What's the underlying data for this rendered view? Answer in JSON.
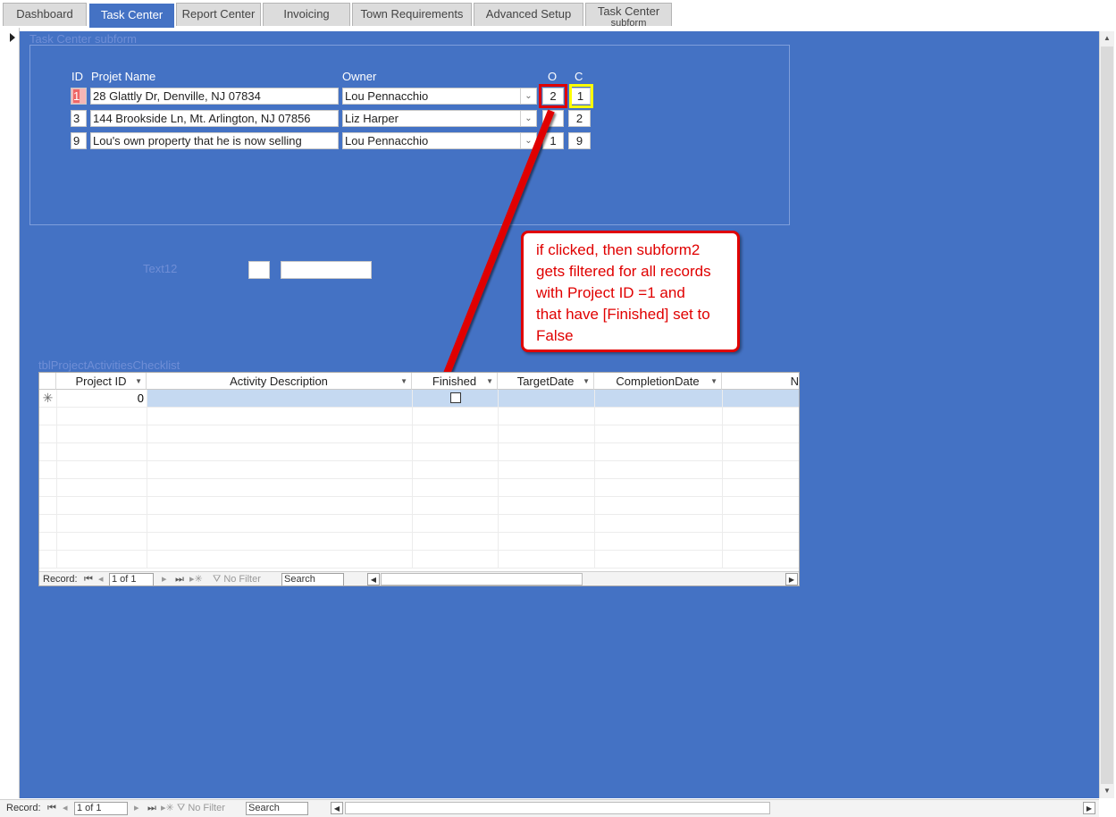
{
  "tabs": [
    {
      "label": "Dashboard",
      "active": false
    },
    {
      "label": "Task Center",
      "active": true
    },
    {
      "label": "Report Center",
      "active": false
    },
    {
      "label": "Invoicing",
      "active": false
    },
    {
      "label": "Town Requirements",
      "active": false
    },
    {
      "label": "Advanced Setup",
      "active": false
    },
    {
      "label": "Task Center",
      "active": false,
      "second_line": "subform"
    }
  ],
  "subform": {
    "label": "Task Center subform",
    "headers": {
      "id": "ID",
      "name": "Projet Name",
      "owner": "Owner",
      "o": "O",
      "c": "C"
    },
    "rows": [
      {
        "id": "1",
        "name": "28 Glattly Dr, Denville, NJ 07834",
        "owner": "Lou Pennacchio",
        "o": "2",
        "c": "1"
      },
      {
        "id": "3",
        "name": "144 Brookside Ln, Mt. Arlington, NJ 07856",
        "owner": "Liz Harper",
        "o": "",
        "c": "2"
      },
      {
        "id": "9",
        "name": "Lou's own property that he is now selling",
        "owner": "Lou Pennacchio",
        "o": "1",
        "c": "9"
      }
    ]
  },
  "text12": {
    "label": "Text12",
    "value_small": "",
    "value_large": ""
  },
  "callout": {
    "lines": [
      "if clicked, then subform2",
      "gets filtered for all records",
      "with Project ID =1 and",
      "that have [Finished] set to",
      "False"
    ]
  },
  "checklist": {
    "label": "tblProjectActivitiesChecklist",
    "columns": [
      {
        "label": "Project ID"
      },
      {
        "label": "Activity Description"
      },
      {
        "label": "Finished"
      },
      {
        "label": "TargetDate"
      },
      {
        "label": "CompletionDate"
      },
      {
        "label": "N"
      }
    ],
    "new_row": {
      "project_id": "0",
      "finished": false
    },
    "nav": {
      "record_label": "Record:",
      "position": "1 of 1",
      "filter": "No Filter",
      "search": "Search"
    }
  },
  "main_nav": {
    "record_label": "Record:",
    "position": "1 of 1",
    "filter": "No Filter",
    "search": "Search"
  },
  "colors": {
    "form_bg": "#4472c4",
    "callout_red": "#e00000",
    "highlight_yellow": "#ffff00"
  }
}
